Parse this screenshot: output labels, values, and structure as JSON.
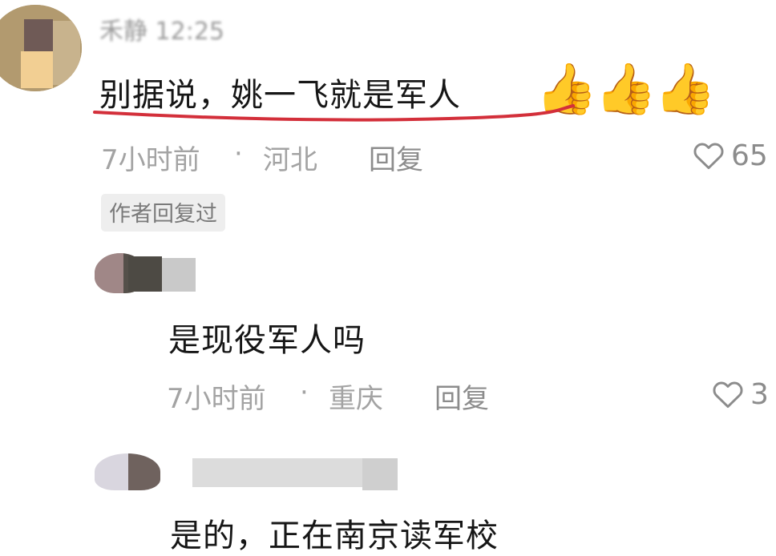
{
  "comments": [
    {
      "username": "禾静 12:25",
      "text": "别据说，姚一飞就是军人",
      "emojis": [
        "👍",
        "👍",
        "👍"
      ],
      "time": "7小时前",
      "separator": "·",
      "location": "河北",
      "reply_label": "回复",
      "likes": "65",
      "author_badge": "作者回复过"
    },
    {
      "text": "是现役军人吗",
      "time": "7小时前",
      "separator": "·",
      "location": "重庆",
      "reply_label": "回复",
      "likes": "3"
    },
    {
      "text": "是的，正在南京读军校"
    }
  ],
  "colors": {
    "underline": "#d32f3a",
    "meta_text": "#a3a3a3",
    "badge_bg": "#eeeeee"
  },
  "icons": {
    "like": "heart-outline-icon",
    "emoji": "thumbs-up-icon"
  }
}
